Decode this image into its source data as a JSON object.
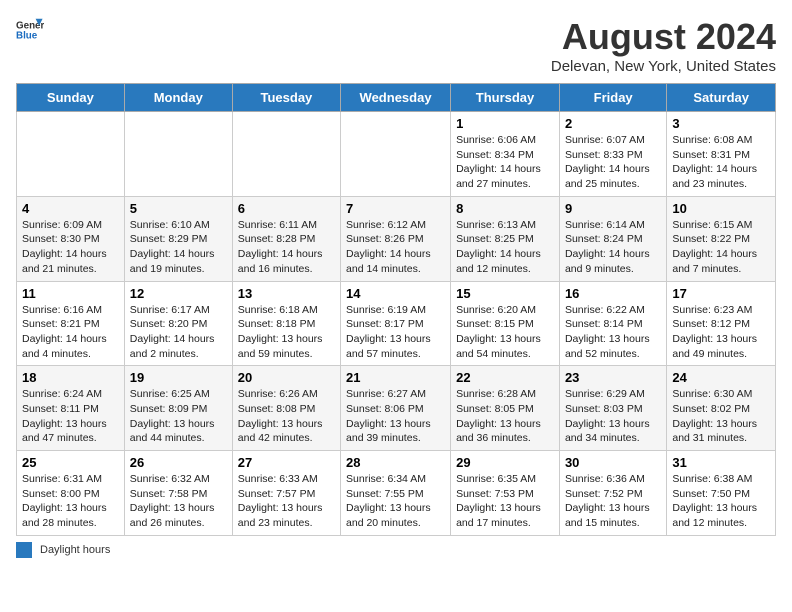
{
  "header": {
    "logo_general": "General",
    "logo_blue": "Blue",
    "title": "August 2024",
    "subtitle": "Delevan, New York, United States"
  },
  "weekdays": [
    "Sunday",
    "Monday",
    "Tuesday",
    "Wednesday",
    "Thursday",
    "Friday",
    "Saturday"
  ],
  "weeks": [
    [
      {
        "day": "",
        "info": ""
      },
      {
        "day": "",
        "info": ""
      },
      {
        "day": "",
        "info": ""
      },
      {
        "day": "",
        "info": ""
      },
      {
        "day": "1",
        "info": "Sunrise: 6:06 AM\nSunset: 8:34 PM\nDaylight: 14 hours and 27 minutes."
      },
      {
        "day": "2",
        "info": "Sunrise: 6:07 AM\nSunset: 8:33 PM\nDaylight: 14 hours and 25 minutes."
      },
      {
        "day": "3",
        "info": "Sunrise: 6:08 AM\nSunset: 8:31 PM\nDaylight: 14 hours and 23 minutes."
      }
    ],
    [
      {
        "day": "4",
        "info": "Sunrise: 6:09 AM\nSunset: 8:30 PM\nDaylight: 14 hours and 21 minutes."
      },
      {
        "day": "5",
        "info": "Sunrise: 6:10 AM\nSunset: 8:29 PM\nDaylight: 14 hours and 19 minutes."
      },
      {
        "day": "6",
        "info": "Sunrise: 6:11 AM\nSunset: 8:28 PM\nDaylight: 14 hours and 16 minutes."
      },
      {
        "day": "7",
        "info": "Sunrise: 6:12 AM\nSunset: 8:26 PM\nDaylight: 14 hours and 14 minutes."
      },
      {
        "day": "8",
        "info": "Sunrise: 6:13 AM\nSunset: 8:25 PM\nDaylight: 14 hours and 12 minutes."
      },
      {
        "day": "9",
        "info": "Sunrise: 6:14 AM\nSunset: 8:24 PM\nDaylight: 14 hours and 9 minutes."
      },
      {
        "day": "10",
        "info": "Sunrise: 6:15 AM\nSunset: 8:22 PM\nDaylight: 14 hours and 7 minutes."
      }
    ],
    [
      {
        "day": "11",
        "info": "Sunrise: 6:16 AM\nSunset: 8:21 PM\nDaylight: 14 hours and 4 minutes."
      },
      {
        "day": "12",
        "info": "Sunrise: 6:17 AM\nSunset: 8:20 PM\nDaylight: 14 hours and 2 minutes."
      },
      {
        "day": "13",
        "info": "Sunrise: 6:18 AM\nSunset: 8:18 PM\nDaylight: 13 hours and 59 minutes."
      },
      {
        "day": "14",
        "info": "Sunrise: 6:19 AM\nSunset: 8:17 PM\nDaylight: 13 hours and 57 minutes."
      },
      {
        "day": "15",
        "info": "Sunrise: 6:20 AM\nSunset: 8:15 PM\nDaylight: 13 hours and 54 minutes."
      },
      {
        "day": "16",
        "info": "Sunrise: 6:22 AM\nSunset: 8:14 PM\nDaylight: 13 hours and 52 minutes."
      },
      {
        "day": "17",
        "info": "Sunrise: 6:23 AM\nSunset: 8:12 PM\nDaylight: 13 hours and 49 minutes."
      }
    ],
    [
      {
        "day": "18",
        "info": "Sunrise: 6:24 AM\nSunset: 8:11 PM\nDaylight: 13 hours and 47 minutes."
      },
      {
        "day": "19",
        "info": "Sunrise: 6:25 AM\nSunset: 8:09 PM\nDaylight: 13 hours and 44 minutes."
      },
      {
        "day": "20",
        "info": "Sunrise: 6:26 AM\nSunset: 8:08 PM\nDaylight: 13 hours and 42 minutes."
      },
      {
        "day": "21",
        "info": "Sunrise: 6:27 AM\nSunset: 8:06 PM\nDaylight: 13 hours and 39 minutes."
      },
      {
        "day": "22",
        "info": "Sunrise: 6:28 AM\nSunset: 8:05 PM\nDaylight: 13 hours and 36 minutes."
      },
      {
        "day": "23",
        "info": "Sunrise: 6:29 AM\nSunset: 8:03 PM\nDaylight: 13 hours and 34 minutes."
      },
      {
        "day": "24",
        "info": "Sunrise: 6:30 AM\nSunset: 8:02 PM\nDaylight: 13 hours and 31 minutes."
      }
    ],
    [
      {
        "day": "25",
        "info": "Sunrise: 6:31 AM\nSunset: 8:00 PM\nDaylight: 13 hours and 28 minutes."
      },
      {
        "day": "26",
        "info": "Sunrise: 6:32 AM\nSunset: 7:58 PM\nDaylight: 13 hours and 26 minutes."
      },
      {
        "day": "27",
        "info": "Sunrise: 6:33 AM\nSunset: 7:57 PM\nDaylight: 13 hours and 23 minutes."
      },
      {
        "day": "28",
        "info": "Sunrise: 6:34 AM\nSunset: 7:55 PM\nDaylight: 13 hours and 20 minutes."
      },
      {
        "day": "29",
        "info": "Sunrise: 6:35 AM\nSunset: 7:53 PM\nDaylight: 13 hours and 17 minutes."
      },
      {
        "day": "30",
        "info": "Sunrise: 6:36 AM\nSunset: 7:52 PM\nDaylight: 13 hours and 15 minutes."
      },
      {
        "day": "31",
        "info": "Sunrise: 6:38 AM\nSunset: 7:50 PM\nDaylight: 13 hours and 12 minutes."
      }
    ]
  ],
  "footer": {
    "label": "Daylight hours"
  }
}
